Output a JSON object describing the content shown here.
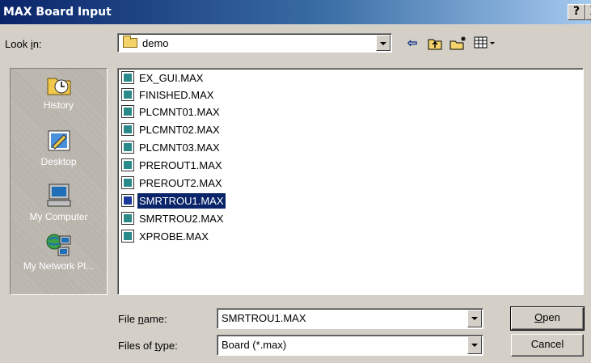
{
  "window": {
    "title": "MAX Board Input",
    "help_label": "?",
    "close_label": "X"
  },
  "look_in": {
    "label_pre": "Look ",
    "label_key": "i",
    "label_post": "n:",
    "value": "demo"
  },
  "toolbar": {
    "back_icon": "back-arrow-icon",
    "up_icon": "up-one-level-icon",
    "new_folder_icon": "new-folder-icon",
    "view_menu_icon": "view-menu-icon"
  },
  "places": [
    {
      "label": "History",
      "icon": "history-icon"
    },
    {
      "label": "Desktop",
      "icon": "desktop-icon"
    },
    {
      "label": "My Computer",
      "icon": "my-computer-icon"
    },
    {
      "label": "My Network Pl...",
      "icon": "my-network-places-icon"
    }
  ],
  "files": [
    {
      "name": "EX_GUI.MAX",
      "selected": false
    },
    {
      "name": "FINISHED.MAX",
      "selected": false
    },
    {
      "name": "PLCMNT01.MAX",
      "selected": false
    },
    {
      "name": "PLCMNT02.MAX",
      "selected": false
    },
    {
      "name": "PLCMNT03.MAX",
      "selected": false
    },
    {
      "name": "PREROUT1.MAX",
      "selected": false
    },
    {
      "name": "PREROUT2.MAX",
      "selected": false
    },
    {
      "name": "SMRTROU1.MAX",
      "selected": true
    },
    {
      "name": "SMRTROU2.MAX",
      "selected": false
    },
    {
      "name": "XPROBE.MAX",
      "selected": false
    }
  ],
  "file_name": {
    "label_pre": "File ",
    "label_key": "n",
    "label_post": "ame:",
    "value": "SMRTROU1.MAX"
  },
  "file_type": {
    "label_pre": "Files of ",
    "label_key": "t",
    "label_post": "ype:",
    "value": "Board (*.max)"
  },
  "buttons": {
    "open_key": "O",
    "open_rest": "pen",
    "cancel": "Cancel"
  },
  "colors": {
    "title_bar": "#0a246a",
    "selection": "#0a246a",
    "face": "#d4d0c8"
  }
}
